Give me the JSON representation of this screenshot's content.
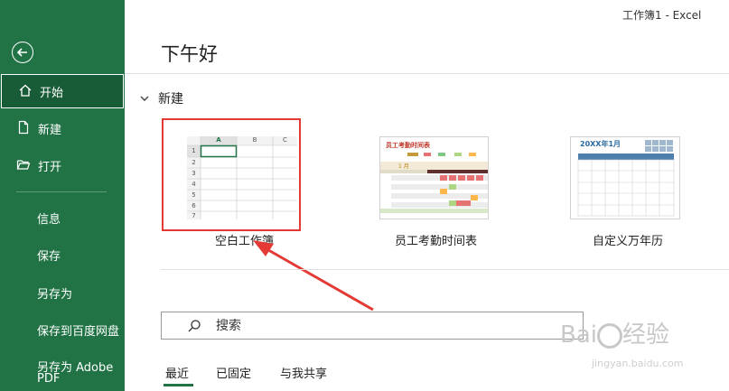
{
  "window": {
    "title": "工作簿1  -  Excel"
  },
  "sidebar": {
    "items": [
      {
        "label": "开始"
      },
      {
        "label": "新建"
      },
      {
        "label": "打开"
      },
      {
        "label": "信息"
      },
      {
        "label": "保存"
      },
      {
        "label": "另存为"
      },
      {
        "label": "保存到百度网盘"
      },
      {
        "label": "另存为 Adobe"
      },
      {
        "label": "PDF"
      }
    ]
  },
  "main": {
    "greeting": "下午好",
    "new_section": "新建",
    "templates": [
      {
        "label": "空白工作簿"
      },
      {
        "label": "员工考勤时间表"
      },
      {
        "label": "自定义万年历"
      }
    ],
    "blank_preview": {
      "columns": [
        "A",
        "B",
        "C"
      ],
      "rows": [
        "1",
        "2",
        "3",
        "4",
        "5",
        "6",
        "7"
      ]
    },
    "attendance_preview": {
      "title": "员工考勤时间表",
      "month": "1 月"
    },
    "calendar_preview": {
      "title": "20XX年1月"
    },
    "search_placeholder": "搜索",
    "tabs": [
      {
        "label": "最近"
      },
      {
        "label": "已固定"
      },
      {
        "label": "与我共享"
      }
    ]
  },
  "colors": {
    "brand": "#217346",
    "active": "#185c37",
    "highlight": "#e53935"
  }
}
